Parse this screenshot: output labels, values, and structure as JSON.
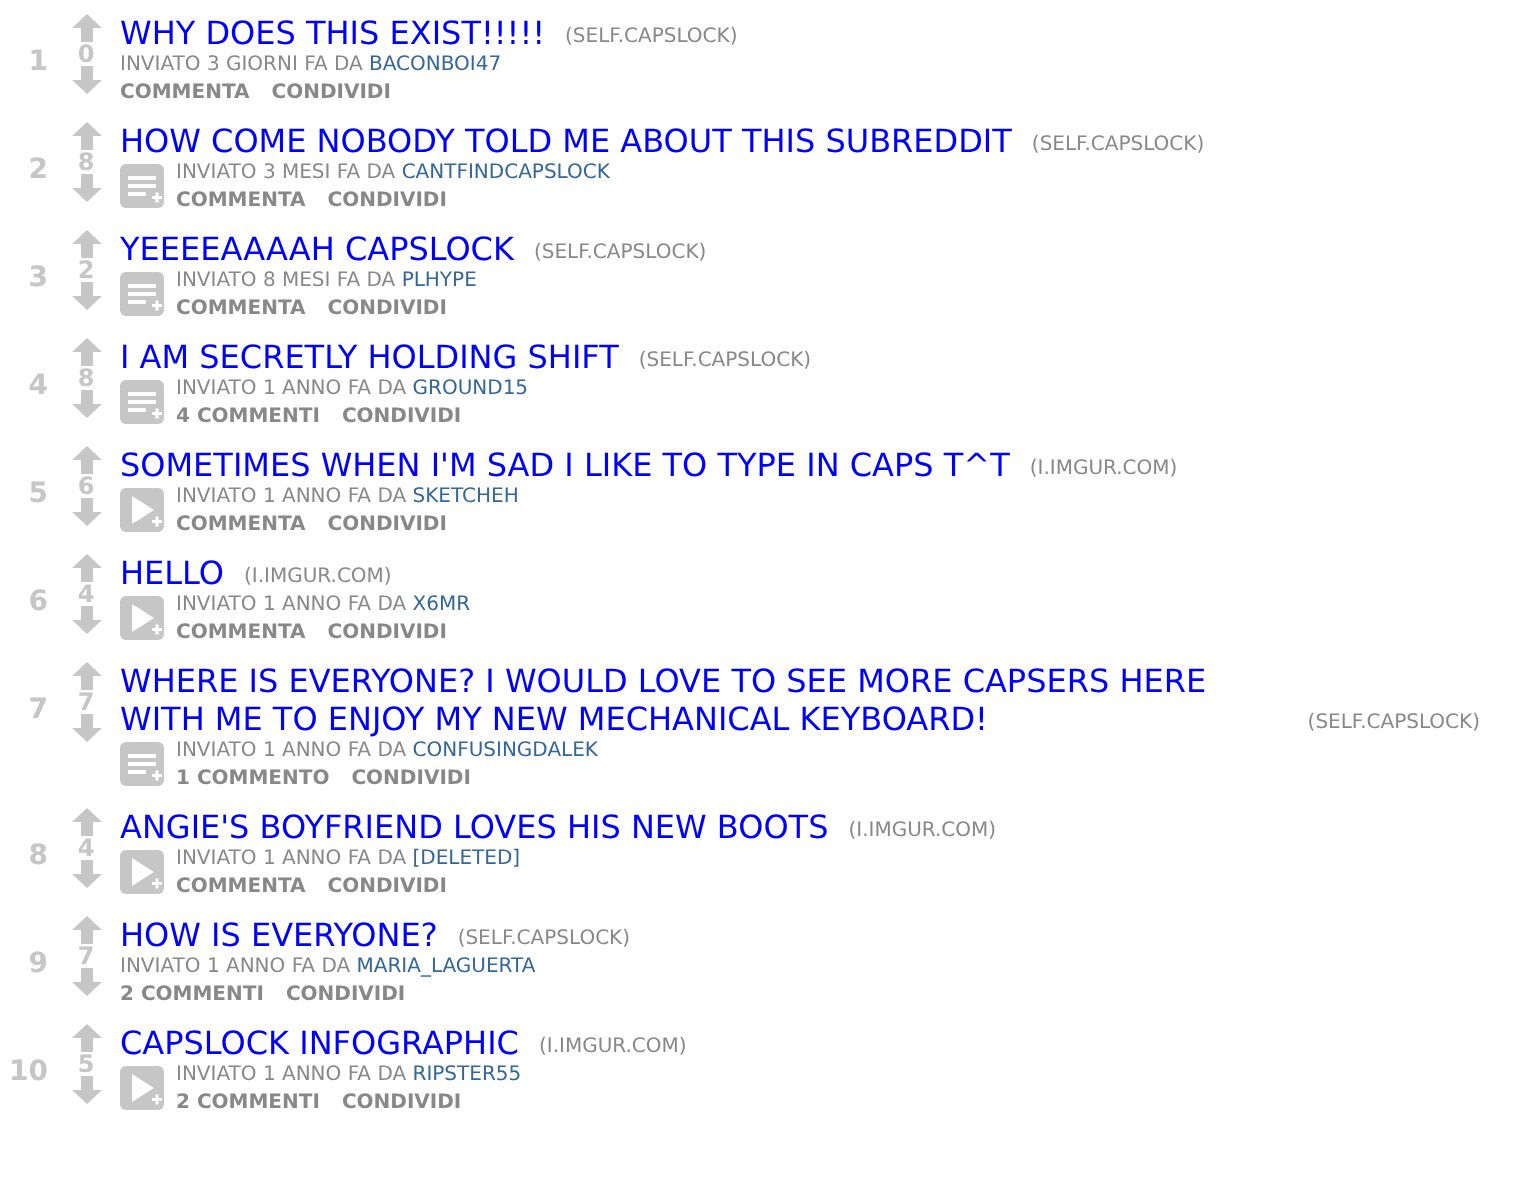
{
  "posts": [
    {
      "rank": "1",
      "score": "0",
      "title": "WHY DOES THIS EXIST!!!!!",
      "domain": "(SELF.CAPSLOCK)",
      "kind": "link",
      "tagline": "INVIATO 3 GIORNI FA DA",
      "author": "BACONBOI47",
      "buttons": [
        "COMMENTA",
        "CONDIVIDI"
      ]
    },
    {
      "rank": "2",
      "score": "8",
      "title": "HOW COME NOBODY TOLD ME ABOUT THIS SUBREDDIT",
      "domain": "(SELF.CAPSLOCK)",
      "kind": "self",
      "tagline": "INVIATO 3 MESI FA DA",
      "author": "CANTFINDCAPSLOCK",
      "buttons": [
        "COMMENTA",
        "CONDIVIDI"
      ]
    },
    {
      "rank": "3",
      "score": "2",
      "title": "YEEEEAAAAH CAPSLOCK",
      "domain": "(SELF.CAPSLOCK)",
      "kind": "self",
      "tagline": "INVIATO 8 MESI FA DA",
      "author": "PLHYPE",
      "buttons": [
        "COMMENTA",
        "CONDIVIDI"
      ]
    },
    {
      "rank": "4",
      "score": "8",
      "title": "I AM SECRETLY HOLDING SHIFT",
      "domain": "(SELF.CAPSLOCK)",
      "kind": "self",
      "tagline": "INVIATO 1 ANNO FA DA",
      "author": "GROUND15",
      "buttons": [
        "4 COMMENTI",
        "CONDIVIDI"
      ]
    },
    {
      "rank": "5",
      "score": "6",
      "title": "SOMETIMES WHEN I'M SAD I LIKE TO TYPE IN CAPS T^T",
      "domain": "(I.IMGUR.COM)",
      "kind": "video",
      "tagline": "INVIATO 1 ANNO FA DA",
      "author": "SKETCHEH",
      "buttons": [
        "COMMENTA",
        "CONDIVIDI"
      ]
    },
    {
      "rank": "6",
      "score": "4",
      "title": "HELLO",
      "domain": "(I.IMGUR.COM)",
      "kind": "video",
      "tagline": "INVIATO 1 ANNO FA DA",
      "author": "X6MR",
      "buttons": [
        "COMMENTA",
        "CONDIVIDI"
      ]
    },
    {
      "rank": "7",
      "score": "7",
      "title": "WHERE IS EVERYONE? I WOULD LOVE TO SEE MORE CAPSERS HERE WITH ME TO ENJOY MY NEW MECHANICAL KEYBOARD!",
      "domain": "(SELF.CAPSLOCK)",
      "kind": "self",
      "tagline": "INVIATO 1 ANNO FA DA",
      "author": "CONFUSINGDALEK",
      "buttons": [
        "1 COMMENTO",
        "CONDIVIDI"
      ]
    },
    {
      "rank": "8",
      "score": "4",
      "title": "ANGIE'S BOYFRIEND LOVES HIS NEW BOOTS",
      "domain": "(I.IMGUR.COM)",
      "kind": "video",
      "tagline": "INVIATO 1 ANNO FA DA",
      "author": "[DELETED]",
      "buttons": [
        "COMMENTA",
        "CONDIVIDI"
      ]
    },
    {
      "rank": "9",
      "score": "7",
      "title": "HOW IS EVERYONE?",
      "domain": "(SELF.CAPSLOCK)",
      "kind": "link",
      "tagline": "INVIATO 1 ANNO FA DA",
      "author": "MARIA_LAGUERTA",
      "buttons": [
        "2 COMMENTI",
        "CONDIVIDI"
      ]
    },
    {
      "rank": "10",
      "score": "5",
      "title": "CAPSLOCK INFOGRAPHIC",
      "domain": "(I.IMGUR.COM)",
      "kind": "video",
      "tagline": "INVIATO 1 ANNO FA DA",
      "author": "RIPSTER55",
      "buttons": [
        "2 COMMENTI",
        "CONDIVIDI"
      ]
    }
  ]
}
